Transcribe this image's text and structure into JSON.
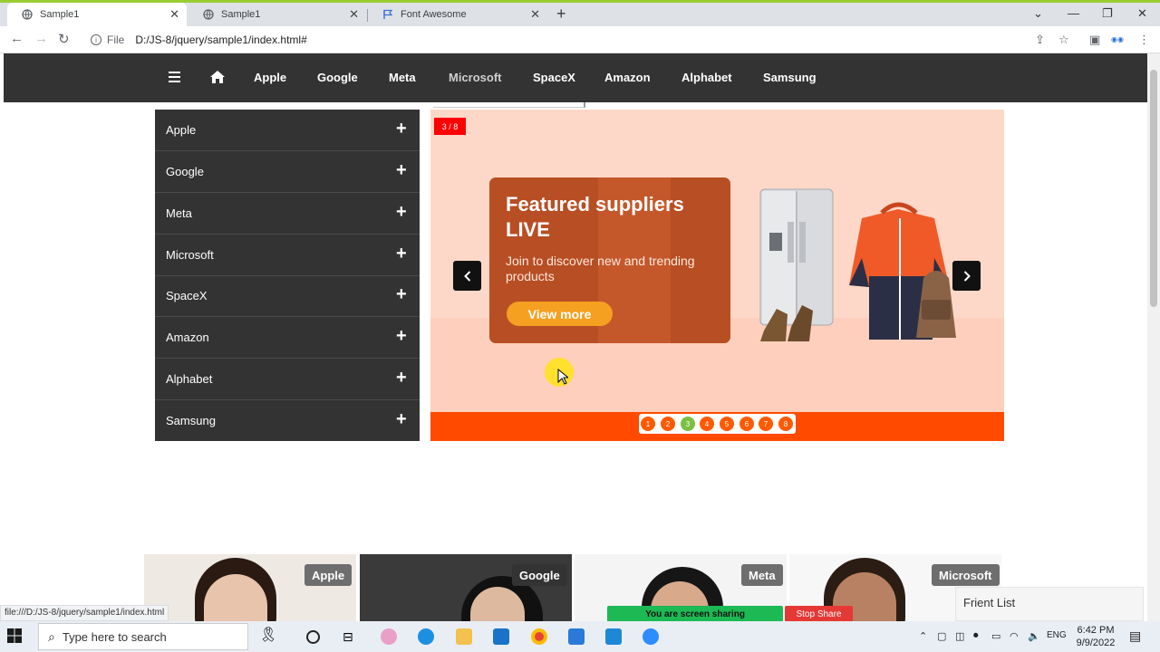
{
  "browser": {
    "tabs": [
      {
        "title": "Sample1",
        "active": true
      },
      {
        "title": "Sample1",
        "active": false
      },
      {
        "title": "Font Awesome",
        "active": false
      }
    ],
    "url_scheme": "File",
    "url": "D:/JS-8/jquery/sample1/index.html#",
    "status_url": "file:///D:/JS-8/jquery/sample1/index.html"
  },
  "nav": {
    "items": [
      "Apple",
      "Google",
      "Meta",
      "Microsoft",
      "SpaceX",
      "Amazon",
      "Alphabet",
      "Samsung"
    ]
  },
  "sidebar": {
    "items": [
      "Apple",
      "Google",
      "Meta",
      "Microsoft",
      "SpaceX",
      "Amazon",
      "Alphabet",
      "Samsung"
    ],
    "expand_glyph": "+"
  },
  "slider": {
    "counter": "3 / 8",
    "current": 3,
    "total": 8,
    "slide_title": "Featured suppliers LIVE",
    "slide_subtitle": "Join to discover new and trending products",
    "slide_button": "View more",
    "dots": [
      "1",
      "2",
      "3",
      "4",
      "5",
      "6",
      "7",
      "8"
    ]
  },
  "cards": [
    {
      "badge": "Apple"
    },
    {
      "badge": "Google"
    },
    {
      "badge": "Meta"
    },
    {
      "badge": "Microsoft"
    }
  ],
  "overlays": {
    "screen_sharing": "You are screen sharing",
    "stop_share": "Stop Share",
    "frient_list": "Frient List"
  },
  "taskbar": {
    "search_placeholder": "Type here to search",
    "language": "ENG",
    "time": "6:42 PM",
    "date": "9/9/2022"
  },
  "colors": {
    "nav_bg": "#333333",
    "slide_accent": "#ff4a00",
    "counter_bg": "#ff0000",
    "active_dot": "#7ac043",
    "share_green": "#1db954",
    "stop_red": "#e53935"
  }
}
